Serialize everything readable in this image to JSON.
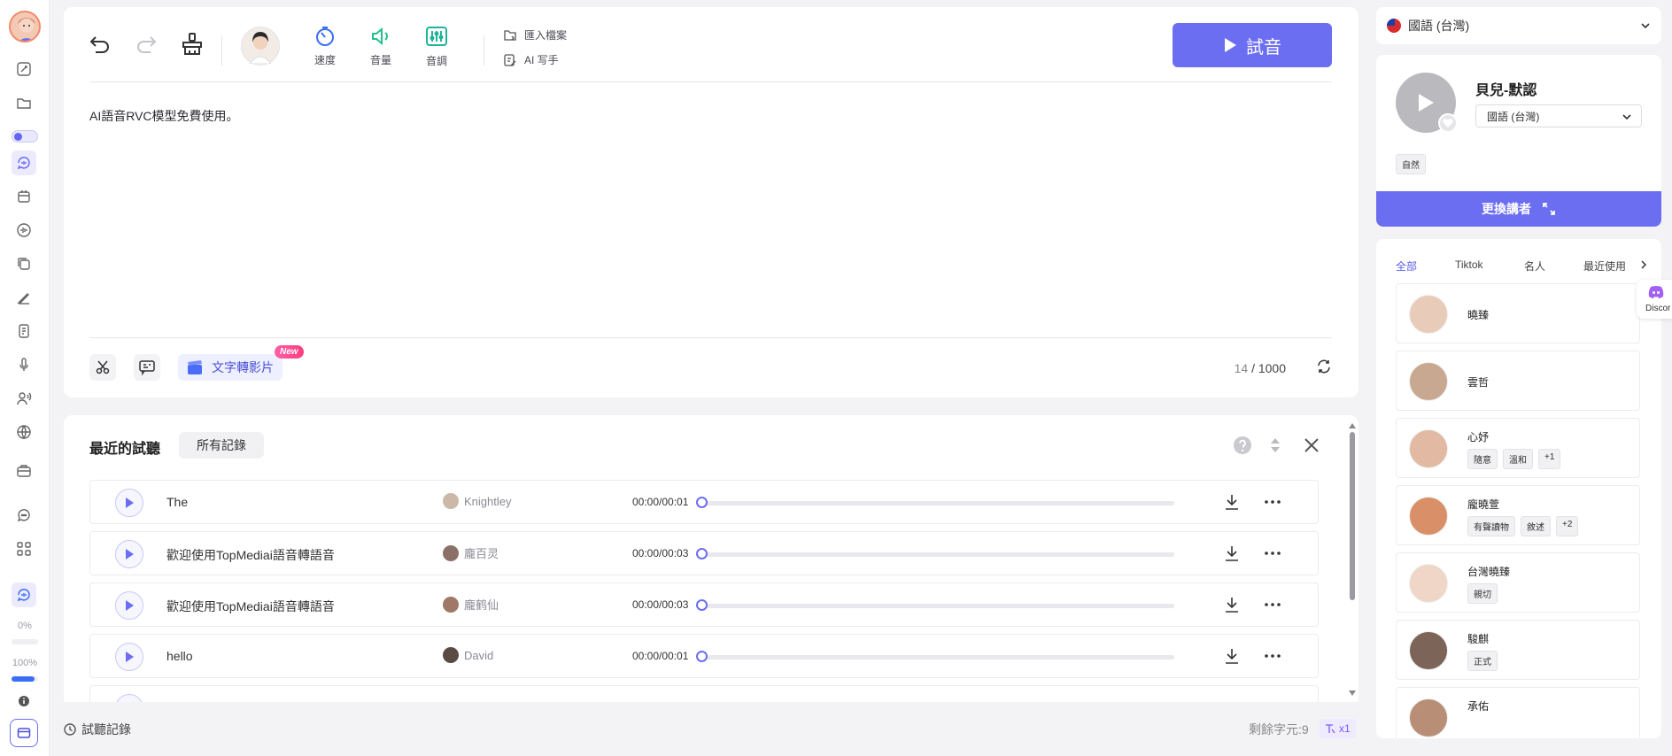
{
  "toolbar": {
    "speed_label": "速度",
    "volume_label": "音量",
    "pitch_label": "音調",
    "import_label": "匯入檔案",
    "ai_writer_label": "AI 写手",
    "play_label": "試音"
  },
  "editor": {
    "text": "AI語音RVC模型免費使用。",
    "text_to_video_label": "文字轉影片",
    "new_badge": "New",
    "char_count": "14",
    "char_max": "/ 1000"
  },
  "recent": {
    "title": "最近的試聽",
    "all_records_label": "所有記錄",
    "rows": [
      {
        "title": "The",
        "voice": "Knightley",
        "time": "00:00/00:01"
      },
      {
        "title": "歡迎使用TopMediai語音轉語音",
        "voice": "龐百灵",
        "time": "00:00/00:03"
      },
      {
        "title": "歡迎使用TopMediai語音轉語音",
        "voice": "龐鹤仙",
        "time": "00:00/00:03"
      },
      {
        "title": "hello",
        "voice": "David",
        "time": "00:00/00:01"
      }
    ]
  },
  "sidebar": {
    "usage_low": "0%",
    "usage_high": "100%",
    "usage_fill": 0.85
  },
  "bottom": {
    "history_label": "試聽記錄",
    "remaining_label": "剩餘字元:9",
    "multiplier": "x1"
  },
  "right": {
    "language": "國語 (台灣)",
    "current_voice": {
      "name": "貝兒-默認",
      "language": "國語 (台灣)",
      "tag": "自然"
    },
    "swap_label": "更換講者",
    "tabs": [
      "全部",
      "Tiktok",
      "名人",
      "最近使用"
    ],
    "voices": [
      {
        "name": "曉臻",
        "tags": []
      },
      {
        "name": "雲哲",
        "tags": []
      },
      {
        "name": "心妤",
        "tags": [
          "隨意",
          "溫和",
          "+1"
        ]
      },
      {
        "name": "龐曉萱",
        "tags": [
          "有聲讀物",
          "敘述",
          "+2"
        ]
      },
      {
        "name": "台灣曉臻",
        "tags": [
          "親切"
        ]
      },
      {
        "name": "駿麒",
        "tags": [
          "正式"
        ]
      },
      {
        "name": "承佑",
        "tags": []
      }
    ],
    "discord_label": "Discor"
  },
  "colors": {
    "accent": "#6c6ef2",
    "accent_light": "#eef0ff",
    "speed_icon": "#3b6ff3",
    "volume_icon": "#22c08a",
    "pitch_icon": "#1fb39a"
  }
}
